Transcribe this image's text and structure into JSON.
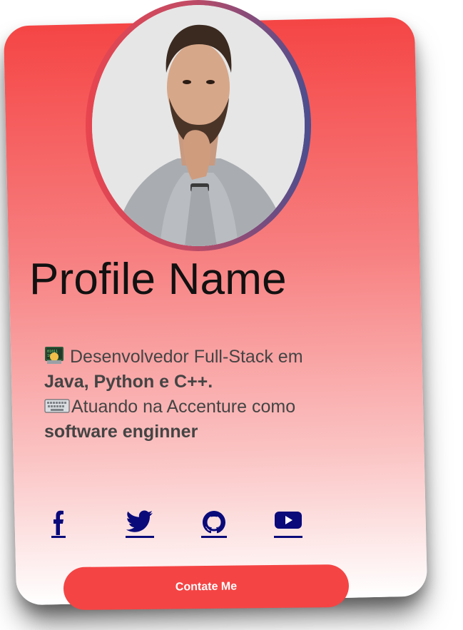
{
  "profile": {
    "name": "Profile Name",
    "avatar_icon": "person-photo"
  },
  "bio": {
    "line1_prefix": "Desenvolvedor Full-Stack em ",
    "line1_bold": "Java, Python e C++.",
    "line2_prefix": "Atuando na Accenture como ",
    "line2_bold": "software enginner",
    "icons": [
      "technologist-emoji",
      "keyboard-emoji"
    ]
  },
  "social": {
    "links": [
      {
        "icon": "facebook-icon"
      },
      {
        "icon": "twitter-icon"
      },
      {
        "icon": "github-icon"
      },
      {
        "icon": "youtube-icon"
      }
    ],
    "color": "#0a0a7a"
  },
  "contact": {
    "button_label": "Contate Me"
  },
  "colors": {
    "card_top": "#f54545",
    "card_bottom": "#ffffff",
    "button": "#f54444",
    "ring_start": "#e8454f",
    "ring_end": "#4a4e8f"
  }
}
